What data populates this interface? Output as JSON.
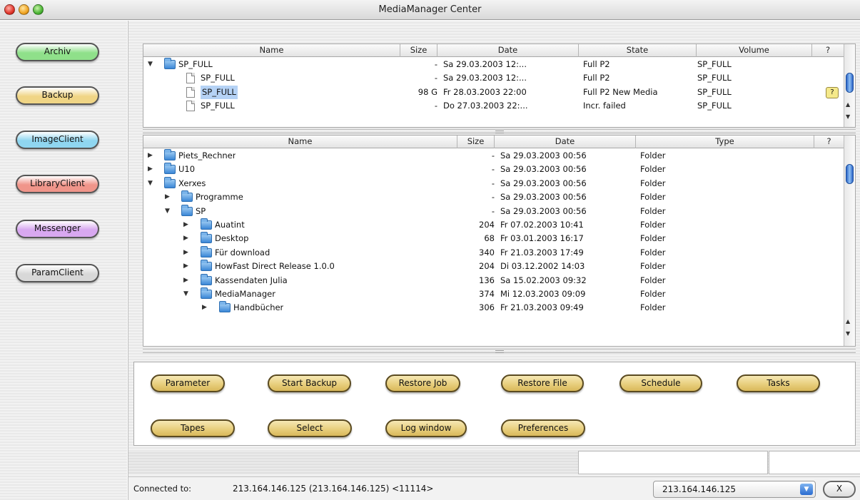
{
  "window": {
    "title": "MediaManager Center"
  },
  "sidebar": {
    "buttons": [
      {
        "label": "Archiv",
        "color": "#8fe08a"
      },
      {
        "label": "Backup",
        "color": "#f0d585"
      },
      {
        "label": "ImageClient",
        "color": "#8fd6f0"
      },
      {
        "label": "LibraryClient",
        "color": "#f0958a"
      },
      {
        "label": "Messenger",
        "color": "#d8a8f0"
      },
      {
        "label": "ParamClient",
        "color": "#d8d8d8"
      }
    ]
  },
  "archive_table": {
    "headers": {
      "name": "Name",
      "size": "Size",
      "date": "Date",
      "state": "State",
      "volume": "Volume",
      "help": "?"
    },
    "rows": [
      {
        "name": "SP_FULL",
        "size": "-",
        "date": "Sa 29.03.2003 12:...",
        "state": "Full P2",
        "volume": "SP_FULL"
      },
      {
        "name": "SP_FULL",
        "size": "-",
        "date": "Sa 29.03.2003 12:...",
        "state": "Full P2",
        "volume": "SP_FULL"
      },
      {
        "name": "SP_FULL",
        "size": "98 G",
        "date": "Fr 28.03.2003 22:00",
        "state": "Full P2 New Media",
        "volume": "SP_FULL"
      },
      {
        "name": "SP_FULL",
        "size": "-",
        "date": "Do 27.03.2003 22:...",
        "state": "Incr. failed",
        "volume": "SP_FULL"
      }
    ],
    "help_badge": "?"
  },
  "file_table": {
    "headers": {
      "name": "Name",
      "size": "Size",
      "date": "Date",
      "type": "Type",
      "help": "?"
    },
    "rows": [
      {
        "name": "Piets_Rechner",
        "size": "-",
        "date": "Sa 29.03.2003 00:56",
        "type": "Folder"
      },
      {
        "name": "U10",
        "size": "-",
        "date": "Sa 29.03.2003 00:56",
        "type": "Folder"
      },
      {
        "name": "Xerxes",
        "size": "-",
        "date": "Sa 29.03.2003 00:56",
        "type": "Folder"
      },
      {
        "name": "Programme",
        "size": "-",
        "date": "Sa 29.03.2003 00:56",
        "type": "Folder"
      },
      {
        "name": "SP",
        "size": "-",
        "date": "Sa 29.03.2003 00:56",
        "type": "Folder"
      },
      {
        "name": "Auatint",
        "size": "204",
        "date": "Fr 07.02.2003 10:41",
        "type": "Folder"
      },
      {
        "name": "Desktop",
        "size": "68",
        "date": "Fr 03.01.2003 16:17",
        "type": "Folder"
      },
      {
        "name": "Für download",
        "size": "340",
        "date": "Fr 21.03.2003 17:49",
        "type": "Folder"
      },
      {
        "name": "HowFast Direct Release 1.0.0",
        "size": "204",
        "date": "Di 03.12.2002 14:03",
        "type": "Folder"
      },
      {
        "name": "Kassendaten Julia",
        "size": "136",
        "date": "Sa 15.02.2003 09:32",
        "type": "Folder"
      },
      {
        "name": "MediaManager",
        "size": "374",
        "date": "Mi 12.03.2003 09:09",
        "type": "Folder"
      },
      {
        "name": "Handbücher",
        "size": "306",
        "date": "Fr 21.03.2003 09:49",
        "type": "Folder"
      }
    ]
  },
  "actions": {
    "parameter": "Parameter",
    "start_backup": "Start Backup",
    "restore_job": "Restore Job",
    "restore_file": "Restore File",
    "schedule": "Schedule",
    "tasks": "Tasks",
    "tapes": "Tapes",
    "select": "Select",
    "log_window": "Log window",
    "preferences": "Preferences"
  },
  "connection": {
    "label": "Connected to:",
    "value": "213.164.146.125 (213.164.146.125) <11114>",
    "host_select": "213.164.146.125",
    "close_label": "X"
  }
}
